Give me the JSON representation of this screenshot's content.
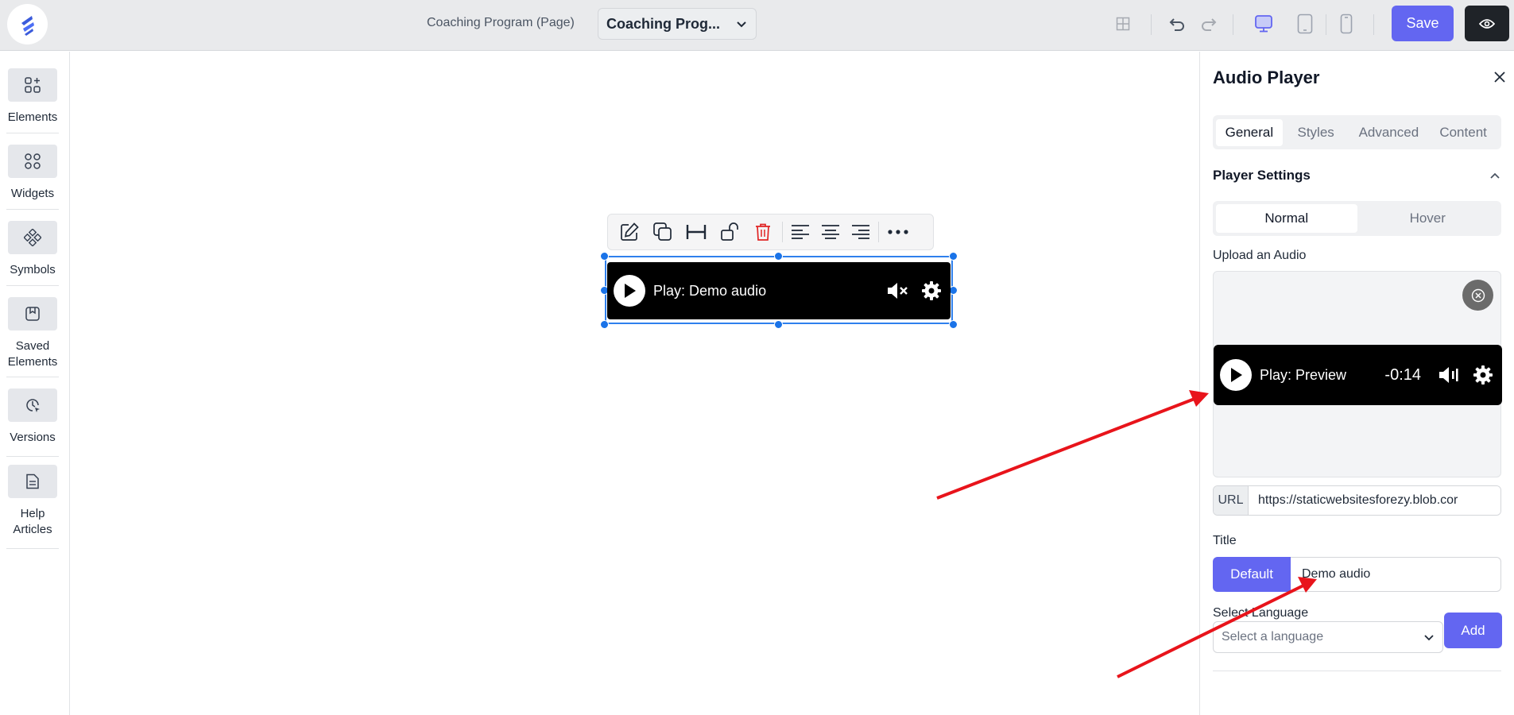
{
  "topbar": {
    "page_label": "Coaching Program (Page)",
    "page_select_value": "Coaching Prog...",
    "save_label": "Save"
  },
  "sidebar": {
    "items": [
      {
        "label": "Elements",
        "icon": "elements-icon"
      },
      {
        "label": "Widgets",
        "icon": "widgets-icon"
      },
      {
        "label": "Symbols",
        "icon": "symbols-icon"
      },
      {
        "label": "Saved Elements",
        "icon": "saved-elements-icon"
      },
      {
        "label": "Versions",
        "icon": "versions-icon"
      },
      {
        "label": "Help Articles",
        "icon": "help-articles-icon"
      }
    ]
  },
  "canvas": {
    "player_title": "Play: Demo audio"
  },
  "panel": {
    "title": "Audio Player",
    "tabs": [
      {
        "label": "General",
        "active": true
      },
      {
        "label": "Styles",
        "active": false
      },
      {
        "label": "Advanced",
        "active": false
      },
      {
        "label": "Content",
        "active": false
      }
    ],
    "section_title": "Player Settings",
    "state_options": [
      {
        "label": "Normal",
        "active": true
      },
      {
        "label": "Hover",
        "active": false
      }
    ],
    "upload_label": "Upload an Audio",
    "preview_title": "Play: Preview",
    "preview_time": "-0:14",
    "url_label": "URL",
    "url_value": "https://staticwebsitesforezy.blob.cor",
    "title_label": "Title",
    "title_default_label": "Default",
    "title_value": "Demo audio",
    "language_label": "Select Language",
    "language_placeholder": "Select a language",
    "add_label": "Add"
  },
  "colors": {
    "accent": "#6366f1",
    "selection": "#2f80ed",
    "annotation_arrow": "#e8141b"
  }
}
